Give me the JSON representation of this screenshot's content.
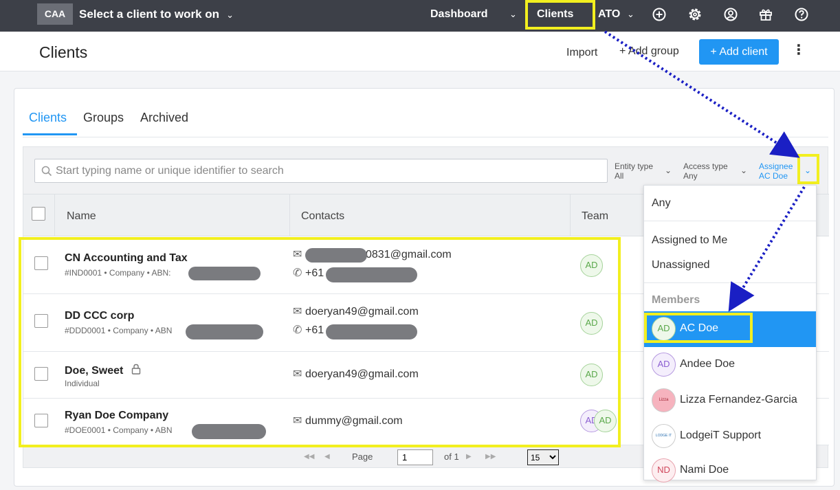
{
  "topbar": {
    "brand": "CAA",
    "client_select": "Select a client to work on",
    "nav": {
      "dashboard": "Dashboard",
      "clients": "Clients",
      "ato": "ATO"
    }
  },
  "pagebar": {
    "title": "Clients",
    "import": "Import",
    "add_group": "+ Add group",
    "add_client": "+ Add client"
  },
  "tabs": [
    "Clients",
    "Groups",
    "Archived"
  ],
  "search": {
    "placeholder": "Start typing name or unique identifier to search"
  },
  "filters": {
    "entity": {
      "label": "Entity type",
      "value": "All"
    },
    "access": {
      "label": "Access type",
      "value": "Any"
    },
    "assignee": {
      "label": "Assignee",
      "value": "AC Doe"
    }
  },
  "table": {
    "columns": [
      "Name",
      "Contacts",
      "Team"
    ],
    "rows": [
      {
        "name": "CN Accounting and Tax",
        "sub": "#IND0001 • Company • ABN:",
        "email": "0831@gmail.com",
        "phone": "+61",
        "avatars": [
          "AD"
        ]
      },
      {
        "name": "DD CCC corp",
        "sub": "#DDD0001 • Company • ABN",
        "email": "doeryan49@gmail.com",
        "phone": "+61",
        "avatars": [
          "AD"
        ]
      },
      {
        "name": "Doe, Sweet",
        "sub": "Individual",
        "email": "doeryan49@gmail.com",
        "phone": "",
        "avatars": [
          "AD"
        ]
      },
      {
        "name": "Ryan Doe Company",
        "sub": "#DOE0001 • Company • ABN",
        "email": "dummy@gmail.com",
        "phone": "",
        "avatars": [
          "AD",
          "AD"
        ]
      }
    ]
  },
  "pager": {
    "page_label": "Page",
    "page_value": "1",
    "of_label": "of 1",
    "page_size": "15"
  },
  "assignee_dropdown": {
    "any": "Any",
    "assigned_to_me": "Assigned to Me",
    "unassigned": "Unassigned",
    "members_heading": "Members",
    "members": [
      {
        "initials": "AD",
        "name": "AC Doe",
        "selected": true
      },
      {
        "initials": "AD",
        "name": "Andee Doe"
      },
      {
        "initials": "Lizza",
        "name": "Lizza Fernandez-Garcia"
      },
      {
        "initials": "LODGE IT",
        "name": "LodgeiT Support"
      },
      {
        "initials": "ND",
        "name": "Nami Doe"
      }
    ]
  },
  "colors": {
    "accent": "#2196f3",
    "topbar": "#3d4048",
    "highlight": "#f2ef1f",
    "arrow": "#1a1fc4"
  }
}
